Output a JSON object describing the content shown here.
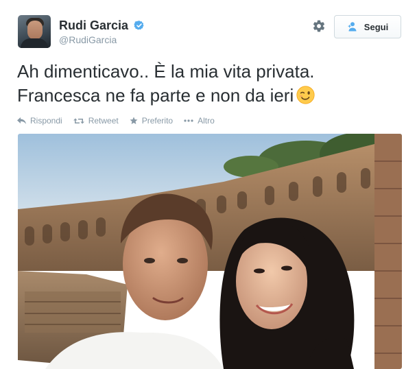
{
  "user": {
    "display_name": "Rudi Garcia",
    "handle": "@RudiGarcia",
    "verified": true
  },
  "follow_button": {
    "label": "Segui"
  },
  "tweet": {
    "text_lines": [
      "Ah dimenticavo.. È la mia vita privata.",
      "Francesca ne fa parte e non da ieri"
    ],
    "emoji": "winking-face"
  },
  "actions": {
    "reply": "Rispondi",
    "retweet": "Retweet",
    "favorite": "Preferito",
    "more": "Altro"
  },
  "colors": {
    "verified_blue": "#55acee",
    "meta_gray": "#8899a6",
    "text": "#292f33"
  }
}
